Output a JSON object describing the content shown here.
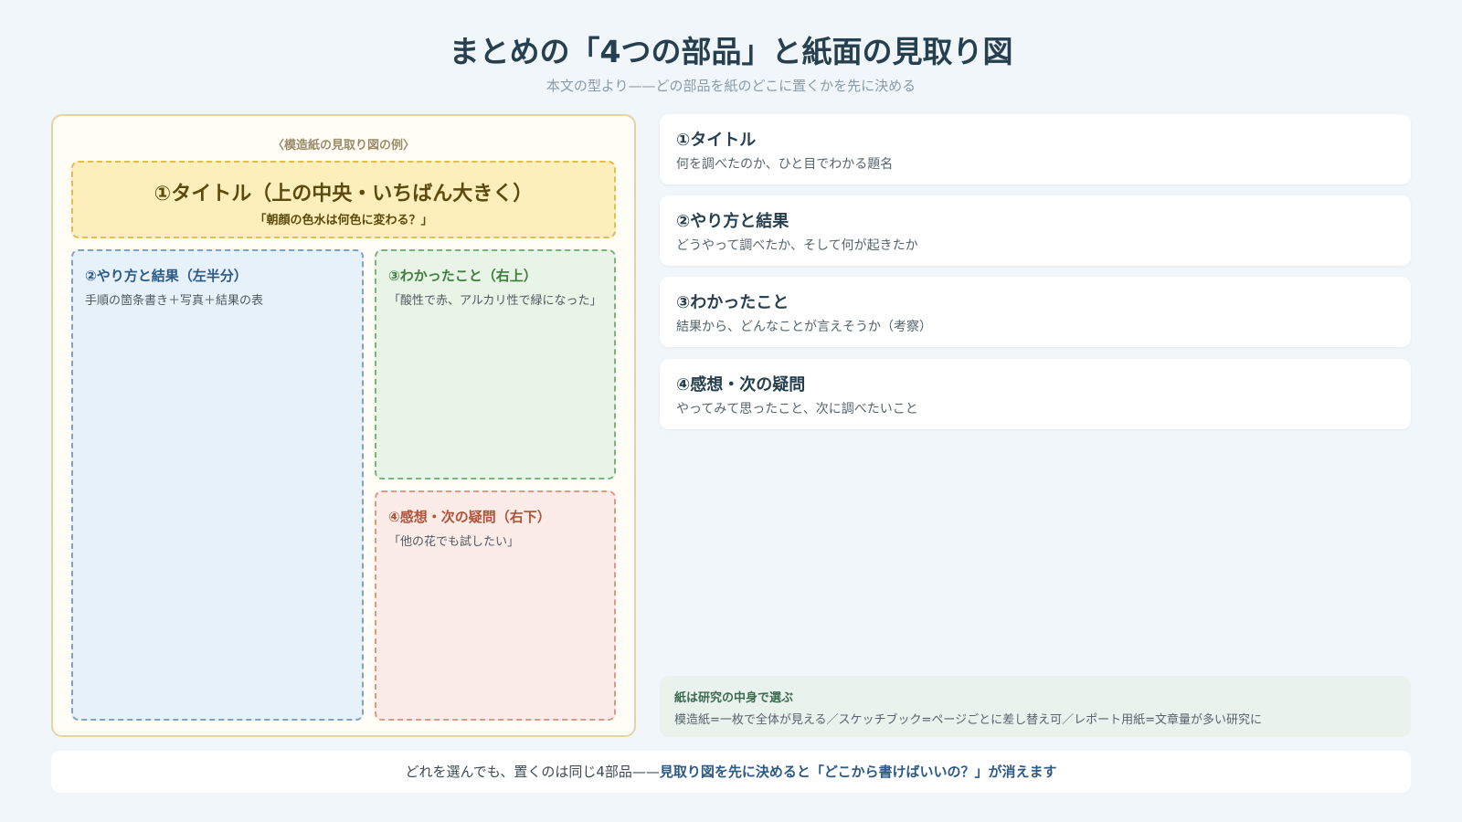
{
  "header": {
    "title": "まとめの「4つの部品」と紙面の見取り図",
    "subtitle": "本文の型より——どの部品を紙のどこに置くかを先に決める"
  },
  "paper": {
    "caption": "〈模造紙の見取り図の例〉",
    "title_zone": {
      "heading": "①タイトル（上の中央・いちばん大きく）",
      "example": "「朝顔の色水は何色に変わる？」"
    },
    "method_zone": {
      "heading": "②やり方と結果（左半分）",
      "description": "手順の箇条書き＋写真＋結果の表"
    },
    "learned_zone": {
      "heading": "③わかったこと（右上）",
      "description": "「酸性で赤、アルカリ性で緑になった」"
    },
    "feelings_zone": {
      "heading": "④感想・次の疑問（右下）",
      "description": "「他の花でも試したい」"
    }
  },
  "parts": [
    {
      "heading": "①タイトル",
      "description": "何を調べたのか、ひと目でわかる題名"
    },
    {
      "heading": "②やり方と結果",
      "description": "どうやって調べたか、そして何が起きたか"
    },
    {
      "heading": "③わかったこと",
      "description": "結果から、どんなことが言えそうか（考察）"
    },
    {
      "heading": "④感想・次の疑問",
      "description": "やってみて思ったこと、次に調べたいこと"
    }
  ],
  "note": {
    "heading": "紙は研究の中身で選ぶ",
    "text": "模造紙=一枚で全体が見える／スケッチブック=ページごとに差し替え可／レポート用紙=文章量が多い研究に"
  },
  "footer": {
    "text": "どれを選んでも、置くのは同じ4部品——",
    "emphasis": "見取り図を先に決めると「どこから書けばいいの？」が消えます"
  },
  "colors": {
    "title_zone": "#fdefbb",
    "method_zone": "#e6f1fa",
    "learned_zone": "#e8f4e6",
    "feelings_zone": "#fbece8"
  }
}
